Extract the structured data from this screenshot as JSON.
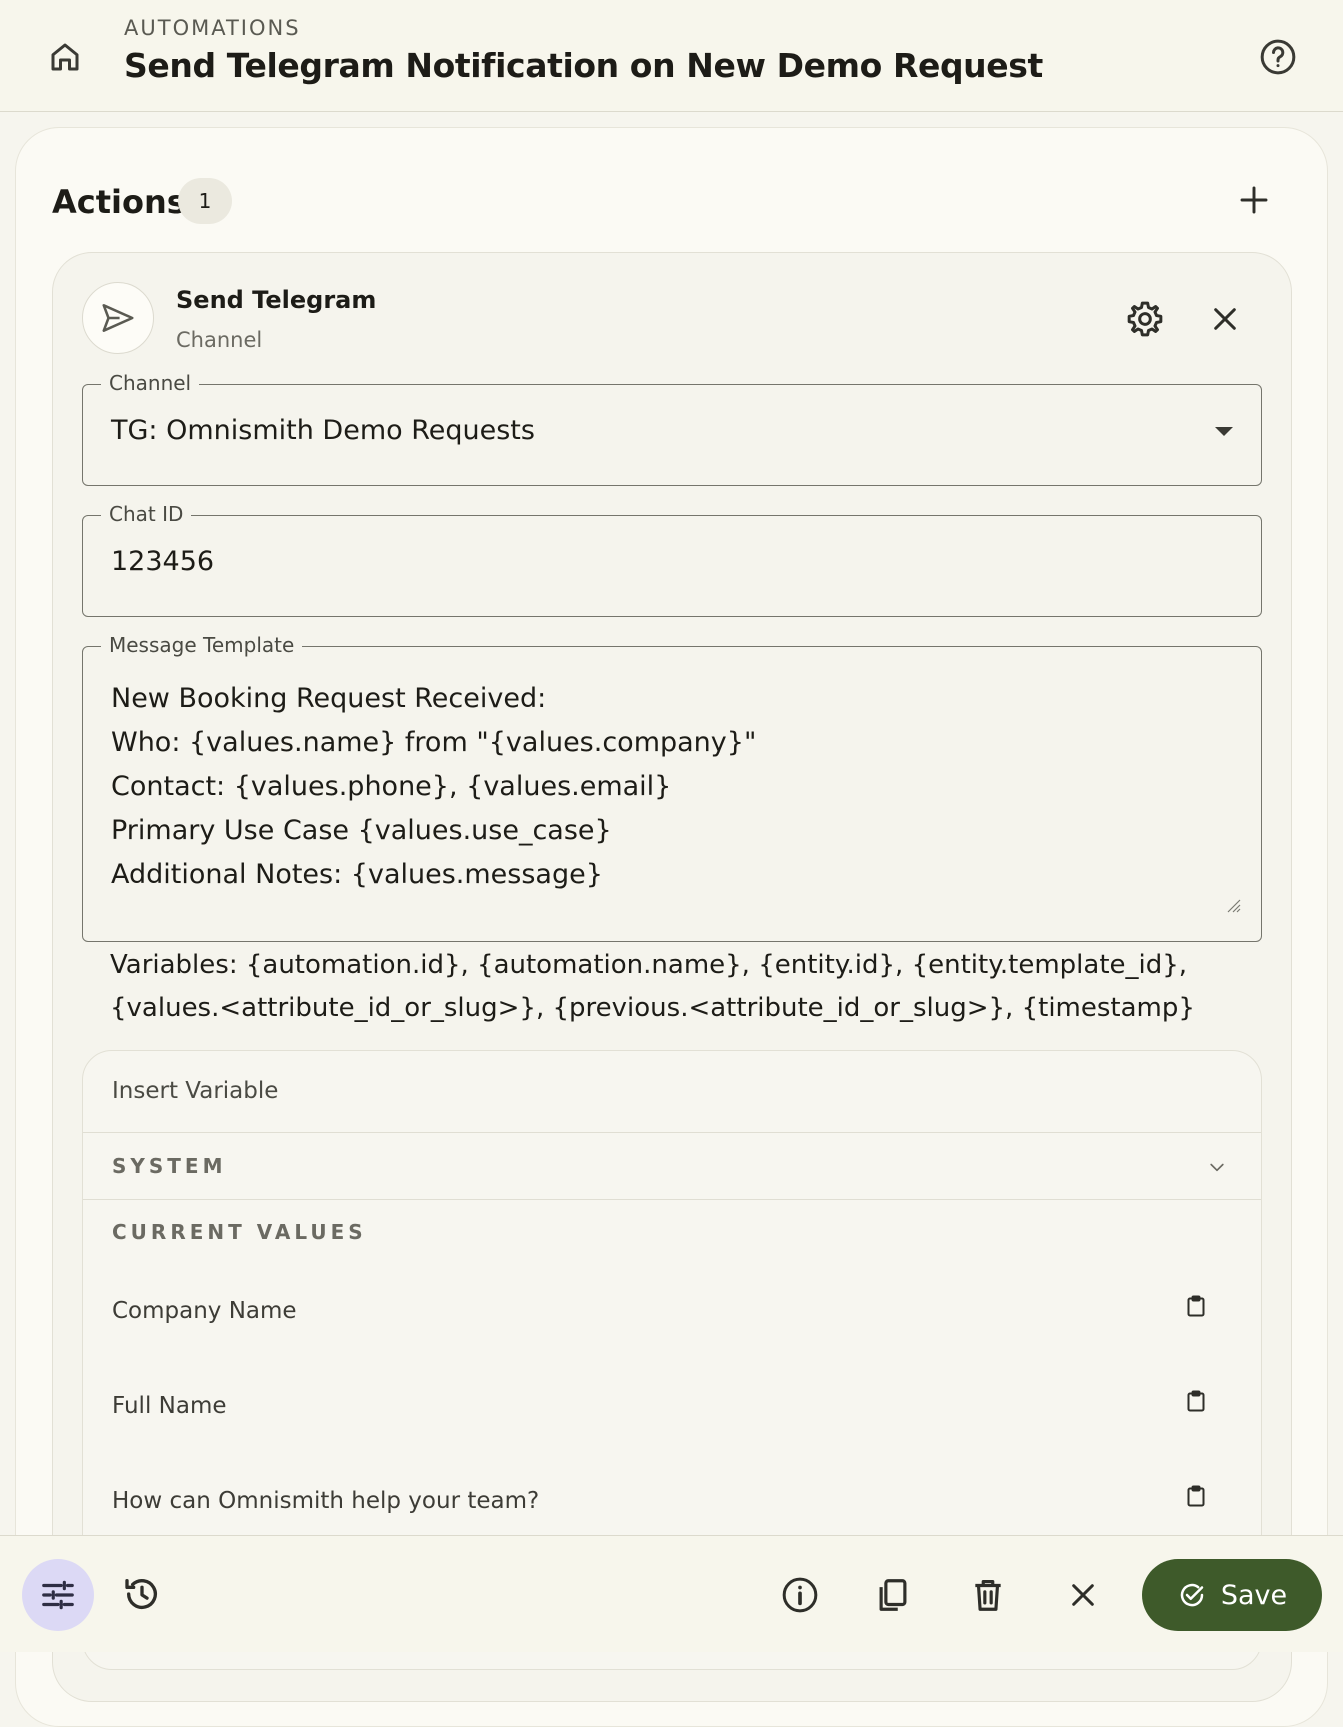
{
  "header": {
    "overline": "AUTOMATIONS",
    "title": "Send Telegram Notification on New Demo Request",
    "home_icon": "home-icon",
    "help_icon": "help-circle-icon"
  },
  "actions": {
    "title": "Actions",
    "count": "1",
    "add_icon": "plus-icon"
  },
  "action_card": {
    "title": "Send Telegram",
    "subtitle": "Channel",
    "icon": "send-icon",
    "fields": {
      "channel": {
        "label": "Channel",
        "value": "TG: Omnismith Demo Requests"
      },
      "chat_id": {
        "label": "Chat ID",
        "value": "123456"
      },
      "message_template": {
        "label": "Message Template",
        "lines": [
          "New Booking Request Received:",
          "Who: {values.name} from \"{values.company}\"",
          "Contact: {values.phone}, {values.email}",
          "Primary Use Case {values.use_case}",
          "Additional Notes: {values.message}"
        ]
      }
    },
    "variables_hint": "Variables: {automation.id}, {automation.name}, {entity.id}, {entity.template_id}, {values.<attribute_id_or_slug>}, {previous.<attribute_id_or_slug>}, {timestamp}"
  },
  "insert_variable": {
    "label": "Insert Variable",
    "sections": [
      {
        "title": "SYSTEM"
      },
      {
        "title": "CURRENT VALUES"
      }
    ],
    "items": [
      {
        "label": "Company Name"
      },
      {
        "label": "Full Name"
      },
      {
        "label": "How can Omnismith help your team?"
      }
    ]
  },
  "bottom_bar": {
    "save_label": "Save"
  },
  "colors": {
    "accent": "#3e5a2a",
    "tune_bg": "#dcd9f5"
  }
}
